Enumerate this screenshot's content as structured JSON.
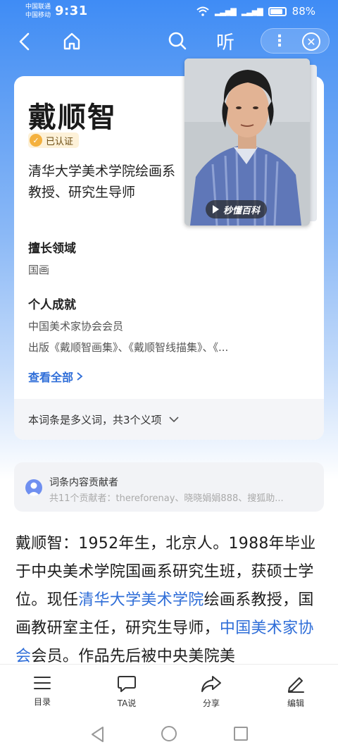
{
  "status": {
    "carrier_line1": "中国联通",
    "carrier_line2": "中国移动",
    "time": "9:31",
    "battery": "88%"
  },
  "nav": {
    "listen_label": "听",
    "icons": [
      "back-icon",
      "home-icon",
      "search-icon",
      "more-icon",
      "close-icon"
    ]
  },
  "profile": {
    "name": "戴顺智",
    "verified_label": "已认证",
    "title": "清华大学美术学院绘画系教授、研究生导师",
    "expertise_heading": "擅长领域",
    "expertise_value": "国画",
    "achievements_heading": "个人成就",
    "achievements": [
      "中国美术家协会会员",
      "出版《戴顺智画集》、《戴顺智线描集》、《..."
    ],
    "view_all": "查看全部",
    "polysemy": "本词条是多义词，共3个义项",
    "photo_badge": "秒懂百科"
  },
  "contributors": {
    "title": "词条内容贡献者",
    "list": "共11个贡献者：thereforenay、晓晓娟娟888、搜狐助..."
  },
  "article": {
    "part1": "戴顺智：1952年生，北京人。1988年毕业于中央美术学院国画系研究生班，获硕士学位。现任",
    "link1": "清华大学美术学院",
    "part2": "绘画系教授，国画教研室主任，研究生导师，",
    "link2": "中国美术家协会",
    "part3": "会员。作品先后被中央美院美"
  },
  "toolbar": {
    "items": [
      {
        "label": "目录",
        "icon": "menu-list-icon"
      },
      {
        "label": "TA说",
        "icon": "chat-bubble-icon"
      },
      {
        "label": "分享",
        "icon": "share-arrow-icon"
      },
      {
        "label": "编辑",
        "icon": "pencil-icon"
      }
    ]
  },
  "colors": {
    "brand_blue": "#3f8cf5",
    "link_blue": "#2f6ed8",
    "verified_gold": "#f4b13e"
  }
}
